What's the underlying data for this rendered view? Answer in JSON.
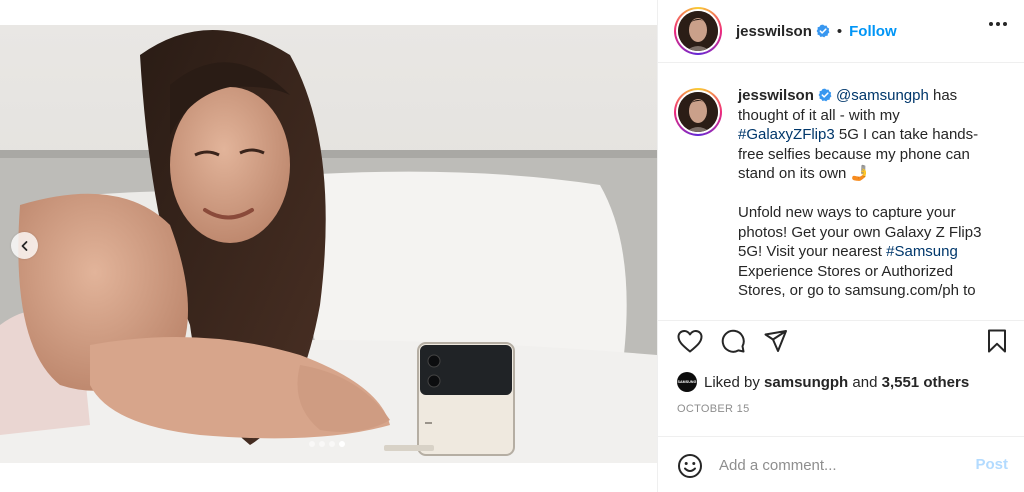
{
  "post": {
    "author": "jesswilson",
    "follow_label": "Follow",
    "separator": "•",
    "caption": {
      "line1_pre": " ",
      "mention": "@samsungph",
      "line1_post": " has thought of it all - with my ",
      "hashtag1": "#GalaxyZFlip3",
      "line2_post": " 5G I can take hands-free selfies because my phone can stand on its own 🤳",
      "para2_pre": "Unfold new ways to capture your photos! Get your own Galaxy Z Flip3 5G! Visit your nearest ",
      "hashtag2": "#Samsung",
      "para2_post": " Experience Stores or Authorized Stores, or go to samsung.com/ph to"
    },
    "likes": {
      "prefix": "Liked by ",
      "by_user": "samsungph",
      "middle": " and ",
      "others": "3,551 others",
      "avatar_text": "SAMSUNG"
    },
    "date": "OCTOBER 15",
    "carousel": {
      "count": 4,
      "active_index": 3
    }
  },
  "comment": {
    "placeholder": "Add a comment...",
    "post_label": "Post"
  },
  "icons": {
    "prev": "chevron-left-icon",
    "like": "heart-icon",
    "comment": "comment-icon",
    "share": "paper-plane-icon",
    "save": "bookmark-icon",
    "emoji": "smiley-icon",
    "more": "ellipsis-icon",
    "verified": "verified-badge-icon"
  },
  "colors": {
    "link": "#00376b",
    "follow": "#0095f6",
    "post_disabled": "#b3dbff",
    "verified": "#3897f0"
  }
}
